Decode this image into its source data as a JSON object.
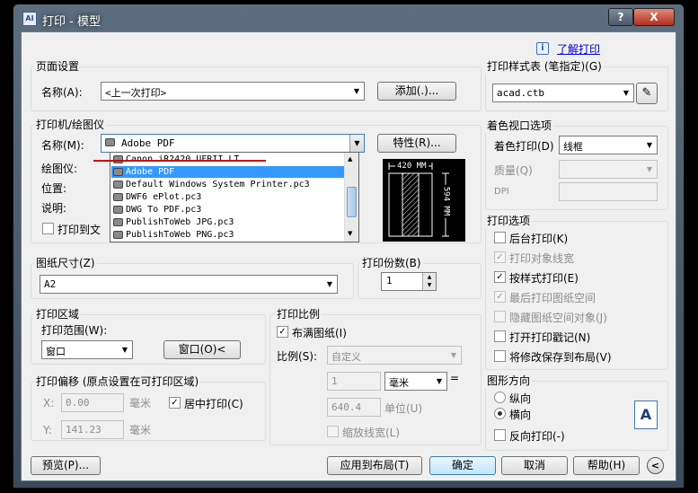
{
  "window": {
    "title": "打印 - 模型",
    "help_label": "?",
    "close_label": "X"
  },
  "header": {
    "info_icon": "i",
    "learn_link": "了解打印"
  },
  "page_setup": {
    "title": "页面设置",
    "name_label": "名称(A):",
    "name_value": "<上一次打印>",
    "add_button": "添加(.)..."
  },
  "printer": {
    "title": "打印机/绘图仪",
    "name_label": "名称(M):",
    "name_value": "Adobe PDF",
    "properties_button": "特性(R)...",
    "plotter_label": "绘图仪:",
    "location_label": "位置:",
    "description_label": "说明:",
    "print_to_file_label": "打印到文",
    "options": [
      "Canon iR2420 UFRII LT",
      "Adobe PDF",
      "Default Windows System Printer.pc3",
      "DWF6 ePlot.pc3",
      "DWG To PDF.pc3",
      "PublishToWeb JPG.pc3",
      "PublishToWeb PNG.pc3"
    ],
    "selected_option": "Adobe PDF",
    "preview_width_label": "420 MM",
    "preview_height_label": "594 MM"
  },
  "paper_size": {
    "title": "图纸尺寸(Z)",
    "value": "A2"
  },
  "copies": {
    "title": "打印份数(B)",
    "value": "1"
  },
  "plot_area": {
    "title": "打印区域",
    "range_label": "打印范围(W):",
    "range_value": "窗口",
    "window_button": "窗口(O)<"
  },
  "plot_offset": {
    "title": "打印偏移 (原点设置在可打印区域)",
    "x_label": "X:",
    "x_value": "0.00",
    "x_unit": "毫米",
    "y_label": "Y:",
    "y_value": "141.23",
    "y_unit": "毫米",
    "center_label": "居中打印(C)"
  },
  "plot_scale": {
    "title": "打印比例",
    "fit_label": "布满图纸(I)",
    "scale_label": "比例(S):",
    "scale_value": "自定义",
    "value1": "1",
    "unit_value": "毫米",
    "equals": "=",
    "value2": "640.4",
    "unit_label": "单位(U)",
    "lineweights_label": "缩放线宽(L)"
  },
  "plot_style": {
    "title": "打印样式表 (笔指定)(G)",
    "value": "acad.ctb"
  },
  "shaded_viewport": {
    "title": "着色视口选项",
    "shade_label": "着色打印(D)",
    "shade_value": "线框",
    "quality_label": "质量(Q)",
    "dpi_label": "DPI"
  },
  "plot_options": {
    "title": "打印选项",
    "items": [
      {
        "label": "后台打印(K)",
        "checked": false,
        "disabled": false
      },
      {
        "label": "打印对象线宽",
        "checked": true,
        "disabled": true
      },
      {
        "label": "按样式打印(E)",
        "checked": true,
        "disabled": false
      },
      {
        "label": "最后打印图纸空间",
        "checked": true,
        "disabled": true
      },
      {
        "label": "隐藏图纸空间对象(J)",
        "checked": false,
        "disabled": true
      },
      {
        "label": "打开打印戳记(N)",
        "checked": false,
        "disabled": false
      },
      {
        "label": "将修改保存到布局(V)",
        "checked": false,
        "disabled": false
      }
    ]
  },
  "orientation": {
    "title": "图形方向",
    "portrait_label": "纵向",
    "landscape_label": "横向",
    "upside_label": "反向打印(-)",
    "icon_letter": "A"
  },
  "footer": {
    "preview_button": "预览(P)...",
    "apply_button": "应用到布局(T)",
    "ok_button": "确定",
    "cancel_button": "取消",
    "help_button": "帮助(H)",
    "more_icon": "<"
  },
  "colors": {
    "accent": "#3399ff",
    "link": "#0000cc",
    "red_line": "#cc0000"
  }
}
